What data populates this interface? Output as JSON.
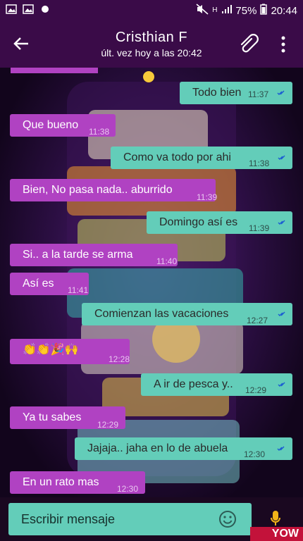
{
  "status_bar": {
    "battery": "75%",
    "time": "20:44",
    "network": "H"
  },
  "header": {
    "title": "Cristhian F",
    "subtitle": "últ. vez hoy a las 20:42"
  },
  "messages": [
    {
      "dir": "out",
      "text": "Todo bien",
      "time": "11:37"
    },
    {
      "dir": "in",
      "text": "Que bueno",
      "time": "11:38"
    },
    {
      "dir": "out",
      "text": "Como va todo por ahi",
      "time": "11:38"
    },
    {
      "dir": "in",
      "text": "Bien, No pasa nada.. aburrido",
      "time": "11:39"
    },
    {
      "dir": "out",
      "text": "Domingo así es",
      "time": "11:39"
    },
    {
      "dir": "in",
      "text": "Si.. a la tarde se arma",
      "time": "11:40"
    },
    {
      "dir": "in",
      "text": "Así es",
      "time": "11:41"
    },
    {
      "dir": "out",
      "text": "Comienzan las vacaciones",
      "time": "12:27"
    },
    {
      "dir": "in",
      "text": "👏👏🎉🙌",
      "time": "12:28"
    },
    {
      "dir": "out",
      "text": "A ir de pesca y..",
      "time": "12:29"
    },
    {
      "dir": "in",
      "text": "Ya tu sabes",
      "time": "12:29"
    },
    {
      "dir": "out",
      "text": "Jajaja.. jaha en lo de abuela",
      "time": "12:30"
    },
    {
      "dir": "in",
      "text": "En un rato mas",
      "time": "12:30"
    }
  ],
  "composer": {
    "placeholder": "Escribir mensaje"
  },
  "watermark": "YOW",
  "colors": {
    "bar": "#3a0b48",
    "incoming": "#b042c2",
    "outgoing": "#63cdb9"
  }
}
